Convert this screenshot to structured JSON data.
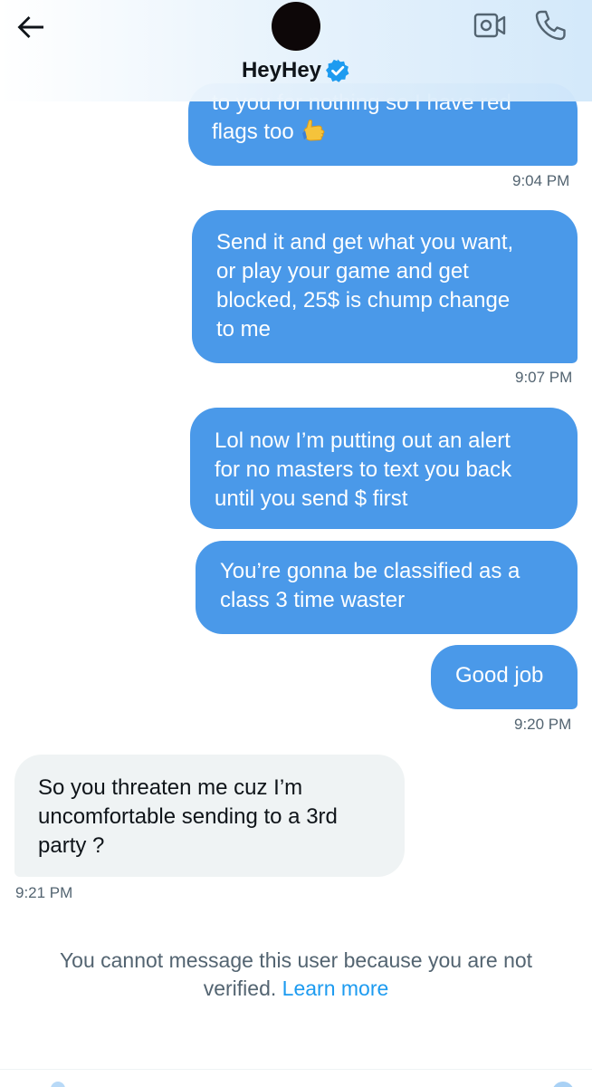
{
  "header": {
    "name": "HeyHey",
    "verified": true
  },
  "messages": [
    {
      "side": "out",
      "lines": [
        "to you for nothing so I have red",
        "flags too"
      ],
      "emoji": "call-me-hand",
      "time": "9:04 PM"
    },
    {
      "side": "out",
      "lines": [
        "Send it and get what you want,",
        "or play your game and get",
        "blocked, 25$ is chump change",
        "to me"
      ],
      "time": "9:07 PM"
    },
    {
      "side": "out",
      "lines": [
        "Lol now I’m putting out an alert",
        "for no masters to text you back",
        "until you send $ first"
      ]
    },
    {
      "side": "out",
      "lines": [
        "You’re gonna be classified as a",
        "class 3 time waster"
      ]
    },
    {
      "side": "out",
      "lines": [
        "Good job"
      ],
      "time": "9:20 PM"
    },
    {
      "side": "in",
      "lines": [
        "So you threaten me cuz I’m",
        "uncomfortable sending to a 3rd",
        "party ?"
      ],
      "time": "9:21 PM"
    }
  ],
  "notice": {
    "line1": "You cannot message this user because you are not",
    "line2_prefix": "verified.",
    "link": "Learn more"
  },
  "colors": {
    "outgoing_bubble": "#4a99e9",
    "incoming_bubble": "#eff3f4",
    "link": "#1d9bf0",
    "verified_badge": "#1d9bf0",
    "timestamp": "#536471"
  }
}
